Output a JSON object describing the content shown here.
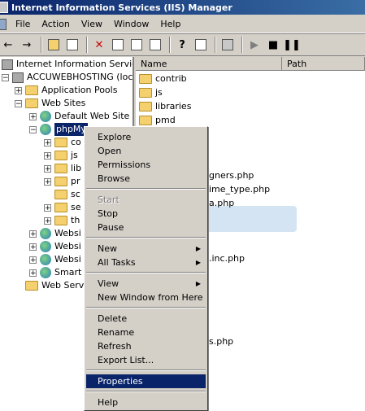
{
  "window": {
    "title": "Internet Information Services (IIS) Manager"
  },
  "menu": [
    "File",
    "Action",
    "View",
    "Window",
    "Help"
  ],
  "toolbar_icons": [
    "back-icon",
    "forward-icon",
    "up-folder-icon",
    "show-hide-tree-icon",
    "delete-icon",
    "properties-icon",
    "refresh-icon",
    "export-icon",
    "help-icon",
    "new-window-icon",
    "computer-icon",
    "play-icon",
    "stop-icon",
    "pause-icon"
  ],
  "tree": {
    "root": "Internet Information Services",
    "server": "ACCUWEBHOSTING (local c",
    "app_pools": "Application Pools",
    "web_sites": "Web Sites",
    "default_site": "Default Web Site",
    "selected_site": "phpMy",
    "children": [
      "co",
      "js",
      "lib",
      "pr",
      "sc",
      "se",
      "th"
    ],
    "other_sites": [
      "Websi",
      "Websi",
      "Websi",
      "Smart"
    ],
    "web_service": "Web Serv"
  },
  "list": {
    "columns": [
      "Name",
      "Path"
    ],
    "folders": [
      "contrib",
      "js",
      "libraries",
      "pmd"
    ],
    "visible_fragments": [
      "gners.php",
      "ime_type.php",
      "a.php",
      ".inc.php",
      "s.php"
    ]
  },
  "context_menu": {
    "items": [
      {
        "label": "Explore"
      },
      {
        "label": "Open"
      },
      {
        "label": "Permissions"
      },
      {
        "label": "Browse"
      },
      {
        "sep": true
      },
      {
        "label": "Start",
        "disabled": true
      },
      {
        "label": "Stop"
      },
      {
        "label": "Pause"
      },
      {
        "sep": true
      },
      {
        "label": "New",
        "submenu": true
      },
      {
        "label": "All Tasks",
        "submenu": true
      },
      {
        "sep": true
      },
      {
        "label": "View",
        "submenu": true
      },
      {
        "label": "New Window from Here"
      },
      {
        "sep": true
      },
      {
        "label": "Delete"
      },
      {
        "label": "Rename"
      },
      {
        "label": "Refresh"
      },
      {
        "label": "Export List..."
      },
      {
        "sep": true
      },
      {
        "label": "Properties",
        "highlighted": true
      },
      {
        "sep": true
      },
      {
        "label": "Help"
      }
    ]
  },
  "colors": {
    "selection": "#0a246a",
    "face": "#d4d0c8",
    "watermark": "#3a86c8"
  }
}
